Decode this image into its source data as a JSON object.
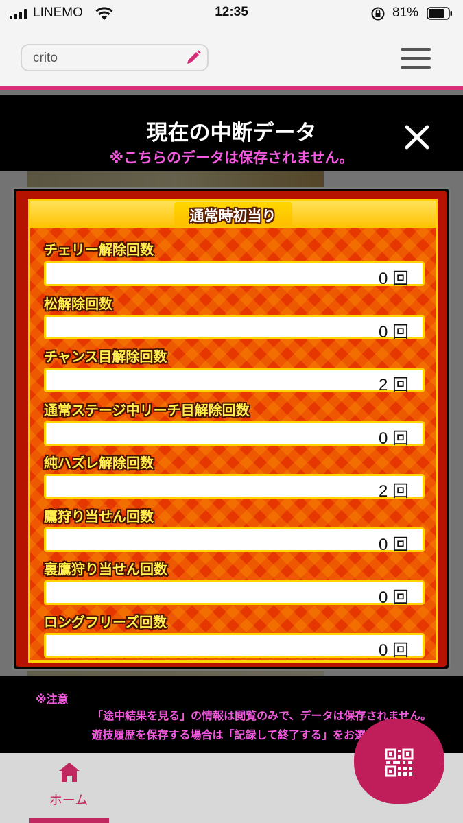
{
  "status_bar": {
    "carrier": "LINEMO",
    "time": "12:35",
    "battery": "81%"
  },
  "header": {
    "search_value": "crito",
    "menu_icon": "hamburger-menu-icon",
    "edit_icon": "pencil-icon"
  },
  "modal": {
    "title": "現在の中断データ",
    "subtitle": "※こちらのデータは保存されません。",
    "close_icon": "close-icon"
  },
  "panel": {
    "banner": "通常時初当り",
    "rows": [
      {
        "label": "チェリー解除回数",
        "value": "0 回"
      },
      {
        "label": "松解除回数",
        "value": "0 回"
      },
      {
        "label": "チャンス目解除回数",
        "value": "2 回"
      },
      {
        "label": "通常ステージ中リーチ目解除回数",
        "value": "0 回"
      },
      {
        "label": "純ハズレ解除回数",
        "value": "2 回"
      },
      {
        "label": "鷹狩り当せん回数",
        "value": "0 回"
      },
      {
        "label": "裏鷹狩り当せん回数",
        "value": "0 回"
      },
      {
        "label": "ロングフリーズ回数",
        "value": "0 回"
      }
    ]
  },
  "notice": {
    "title": "※注意",
    "line1": "「途中結果を見る」の情報は閲覧のみで、データは保存されません。",
    "line2": "遊技履歴を保存する場合は「記録して終了する」をお選びください。"
  },
  "bottom_nav": {
    "home_label": "ホーム",
    "accent": "#c0285f"
  },
  "colors": {
    "header_pink": "#d6307a",
    "subtitle_magenta": "#f45ae0",
    "panel_red": "#e73700",
    "panel_gold": "#ffd400"
  }
}
